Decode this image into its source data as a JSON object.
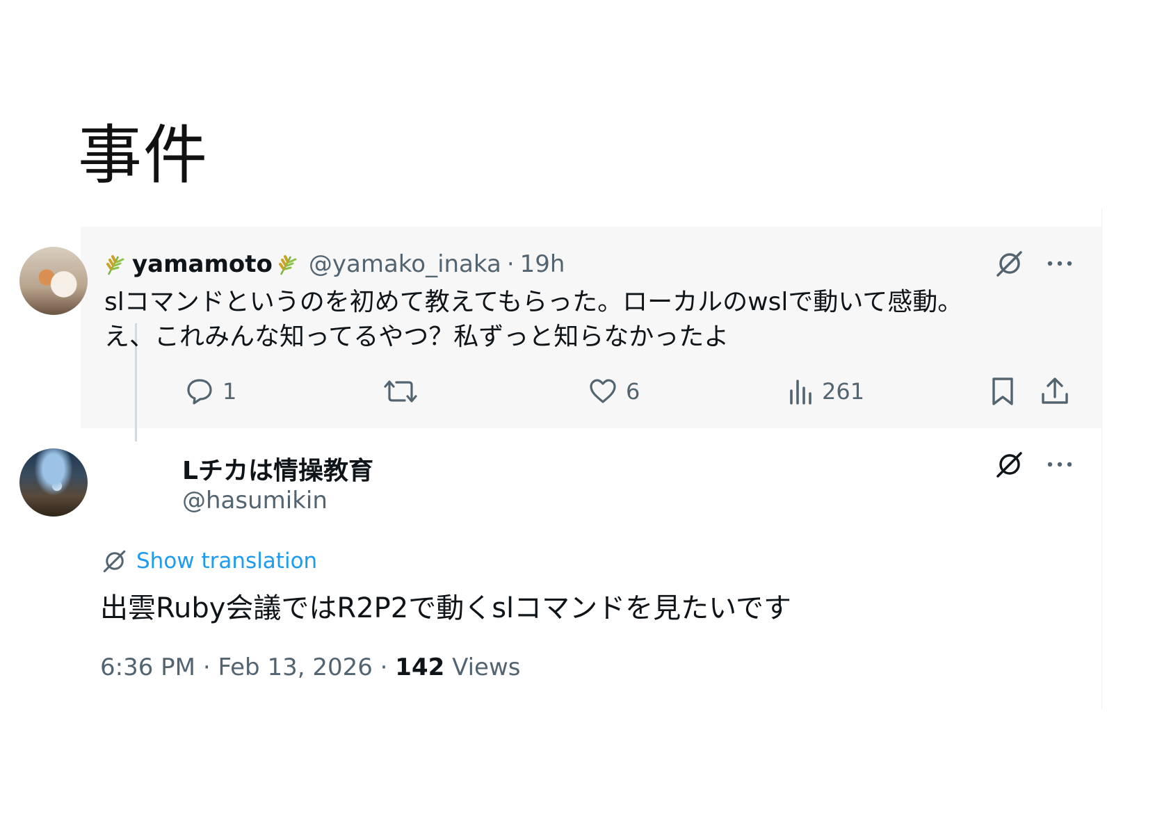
{
  "slide": {
    "title": "事件"
  },
  "parent_tweet": {
    "display_name": "yamamoto",
    "handle": "@yamako_inaka",
    "separator": "·",
    "time": "19h",
    "text_lines": [
      "slコマンドというのを初めて教えてもらった。ローカルのwslで動いて感動。",
      "え、これみんな知ってるやつ？私ずっと知らなかったよ"
    ],
    "reply_count": "1",
    "repost_count": "",
    "like_count": "6",
    "view_count": "261"
  },
  "reply_tweet": {
    "display_name": "Lチカは情操教育",
    "handle": "@hasumikin",
    "show_translation_label": "Show translation",
    "text": "出雲Ruby会議ではR2P2で動くslコマンドを見たいです",
    "time": "6:36 PM",
    "separator1": "·",
    "date": "Feb 13, 2026",
    "separator2": "·",
    "views_count": "142",
    "views_label": "Views"
  },
  "icons": {
    "sprout": "sprout-emoji-icon",
    "grok": "grok-icon",
    "more": "more-icon",
    "reply": "reply-icon",
    "repost": "repost-icon",
    "like": "like-icon",
    "views": "views-icon",
    "bookmark": "bookmark-icon",
    "share": "share-icon",
    "translate": "translate-icon"
  },
  "colors": {
    "primary_text": "#0f1419",
    "secondary_text": "#536471",
    "link_blue": "#1d9bf0",
    "parent_bg": "#f7f7f7",
    "thread_line": "#cfd9de"
  }
}
